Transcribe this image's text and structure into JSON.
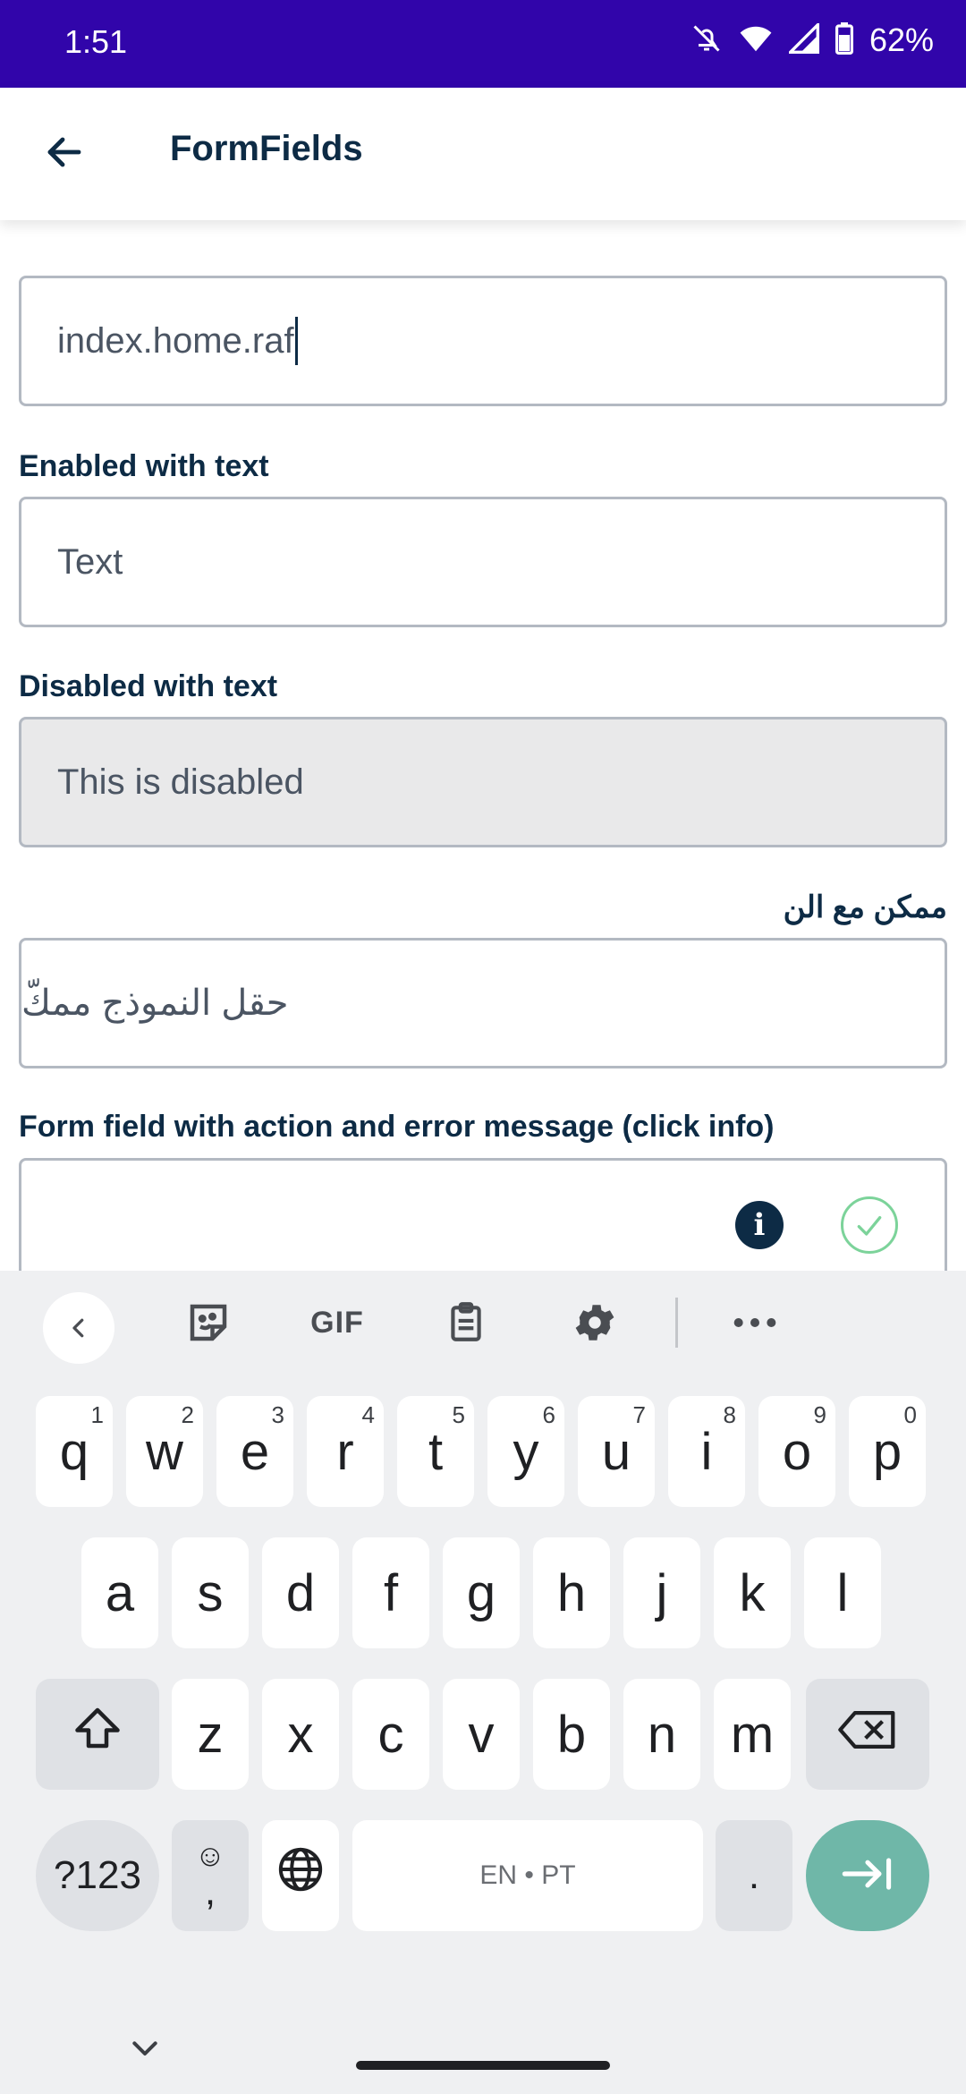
{
  "status_bar": {
    "time": "1:51",
    "battery_percent": "62%",
    "icons": [
      "mute-bell-icon",
      "wifi-icon",
      "signal-icon",
      "battery-icon"
    ]
  },
  "appbar": {
    "title": "FormFields",
    "back_icon": "arrow-left-icon"
  },
  "form": {
    "field1_value": "index.home.raf",
    "enabled_label": "Enabled with text",
    "enabled_placeholder": "Text",
    "disabled_label": "Disabled with text",
    "disabled_value": "This is disabled",
    "rtl_label": "ممكن مع الن",
    "rtl_placeholder": "حقل النموذج ممكّ",
    "action_label": "Form field with action and error message (click info)",
    "info_icon_text": "i"
  },
  "keyboard": {
    "toolbar": [
      "collapse-chevron-icon",
      "sticker-icon",
      "GIF",
      "clipboard-icon",
      "settings-gear-icon",
      "more-dots-icon"
    ],
    "row1": [
      [
        "q",
        "1"
      ],
      [
        "w",
        "2"
      ],
      [
        "e",
        "3"
      ],
      [
        "r",
        "4"
      ],
      [
        "t",
        "5"
      ],
      [
        "y",
        "6"
      ],
      [
        "u",
        "7"
      ],
      [
        "i",
        "8"
      ],
      [
        "o",
        "9"
      ],
      [
        "p",
        "0"
      ]
    ],
    "row2": [
      "a",
      "s",
      "d",
      "f",
      "g",
      "h",
      "j",
      "k",
      "l"
    ],
    "row3": [
      "z",
      "x",
      "c",
      "v",
      "b",
      "n",
      "m"
    ],
    "symbols_key": "?123",
    "emoji_comma_top": "☺",
    "emoji_comma_bottom": ",",
    "space_label": "EN • PT",
    "period_key": ".",
    "colors": {
      "enter": "#6fb7a8",
      "status_bar": "#3105aa"
    }
  }
}
